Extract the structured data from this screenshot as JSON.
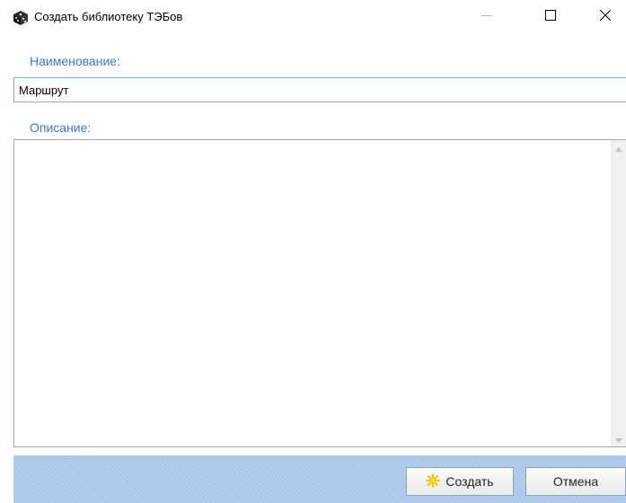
{
  "window": {
    "title": "Создать библиотеку ТЭБов",
    "icon": "dice-cube-icon"
  },
  "form": {
    "name_label": "Наименование:",
    "name_value": "Маршрут",
    "description_label": "Описание:",
    "description_value": ""
  },
  "footer": {
    "create_label": "Создать",
    "create_icon": "sparkle-icon",
    "cancel_label": "Отмена"
  },
  "colors": {
    "label_blue": "#3a78c8",
    "footer_blue": "#a9c8ea",
    "sparkle_yellow": "#f5c400"
  }
}
